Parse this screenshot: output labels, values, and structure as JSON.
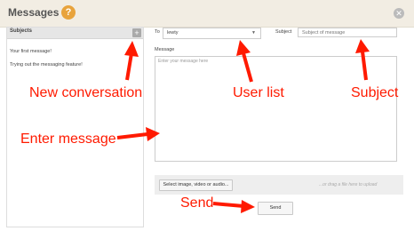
{
  "header": {
    "title": "Messages",
    "help_icon_glyph": "?",
    "close_icon_glyph": "✕"
  },
  "sidebar": {
    "title": "Subjects",
    "add_icon_glyph": "+",
    "conversations": [
      "Your first message!",
      "Trying out the messaging feature!"
    ]
  },
  "form": {
    "to_label": "To",
    "to_value": "lewty",
    "subject_label": "Subject",
    "subject_placeholder": "Subject of message",
    "message_label": "Message",
    "message_placeholder": "Enter your message here",
    "upload_button_label": "Select image, video or audio...",
    "drop_hint": "...or drag a file here to upload",
    "send_label": "Send"
  },
  "annotations": {
    "new_conversation": "New conversation",
    "user_list": "User list",
    "subject": "Subject",
    "enter_message": "Enter message",
    "send": "Send"
  },
  "colors": {
    "annotation": "#ff1a00",
    "help_icon": "#e8a33c",
    "header_bg": "#f2ede3"
  },
  "icons": {
    "help": "question-circle-icon",
    "close": "close-circle-icon",
    "add": "plus-icon"
  }
}
